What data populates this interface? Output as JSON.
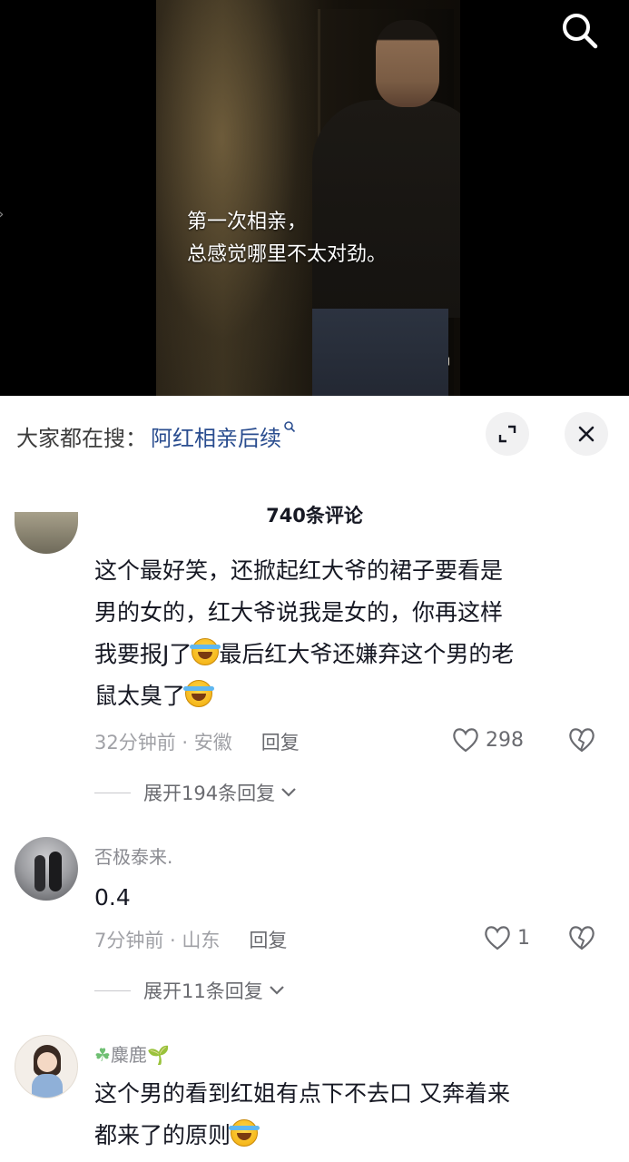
{
  "video": {
    "subtitle_line1": "第一次相亲，",
    "subtitle_line2": "总感觉哪里不太对劲。",
    "search_icon": "search-icon"
  },
  "search_bar": {
    "prefix": "大家都在搜：",
    "term": "阿红相亲后续",
    "expand_icon": "expand-icon",
    "close_icon": "close-icon"
  },
  "comments_header": {
    "count_label": "740条评论"
  },
  "comments": [
    {
      "text_line1": "这个最好笑，还掀起红大爷的裙子要看是",
      "text_line2": "男的女的，红大爷说我是女的，你再这样",
      "text_line3a": "我要报J了",
      "text_line3b": "最后红大爷还嫌弃这个男的老",
      "text_line4": "鼠太臭了",
      "time_location": "32分钟前 · 安徽",
      "reply_label": "回复",
      "likes": "298",
      "expand_label": "展开194条回复"
    },
    {
      "username": "否极泰来.",
      "text": "0.4",
      "time_location": "7分钟前 · 山东",
      "reply_label": "回复",
      "likes": "1",
      "expand_label": "展开11条回复"
    },
    {
      "username": "麋鹿",
      "text_line1": "这个男的看到红姐有点下不去口 又奔着来",
      "text_line2": "都来了的原则"
    }
  ],
  "colors": {
    "link_blue": "#2a4d8f",
    "meta_gray": "#a0a1a6",
    "text_dark": "#161823"
  }
}
